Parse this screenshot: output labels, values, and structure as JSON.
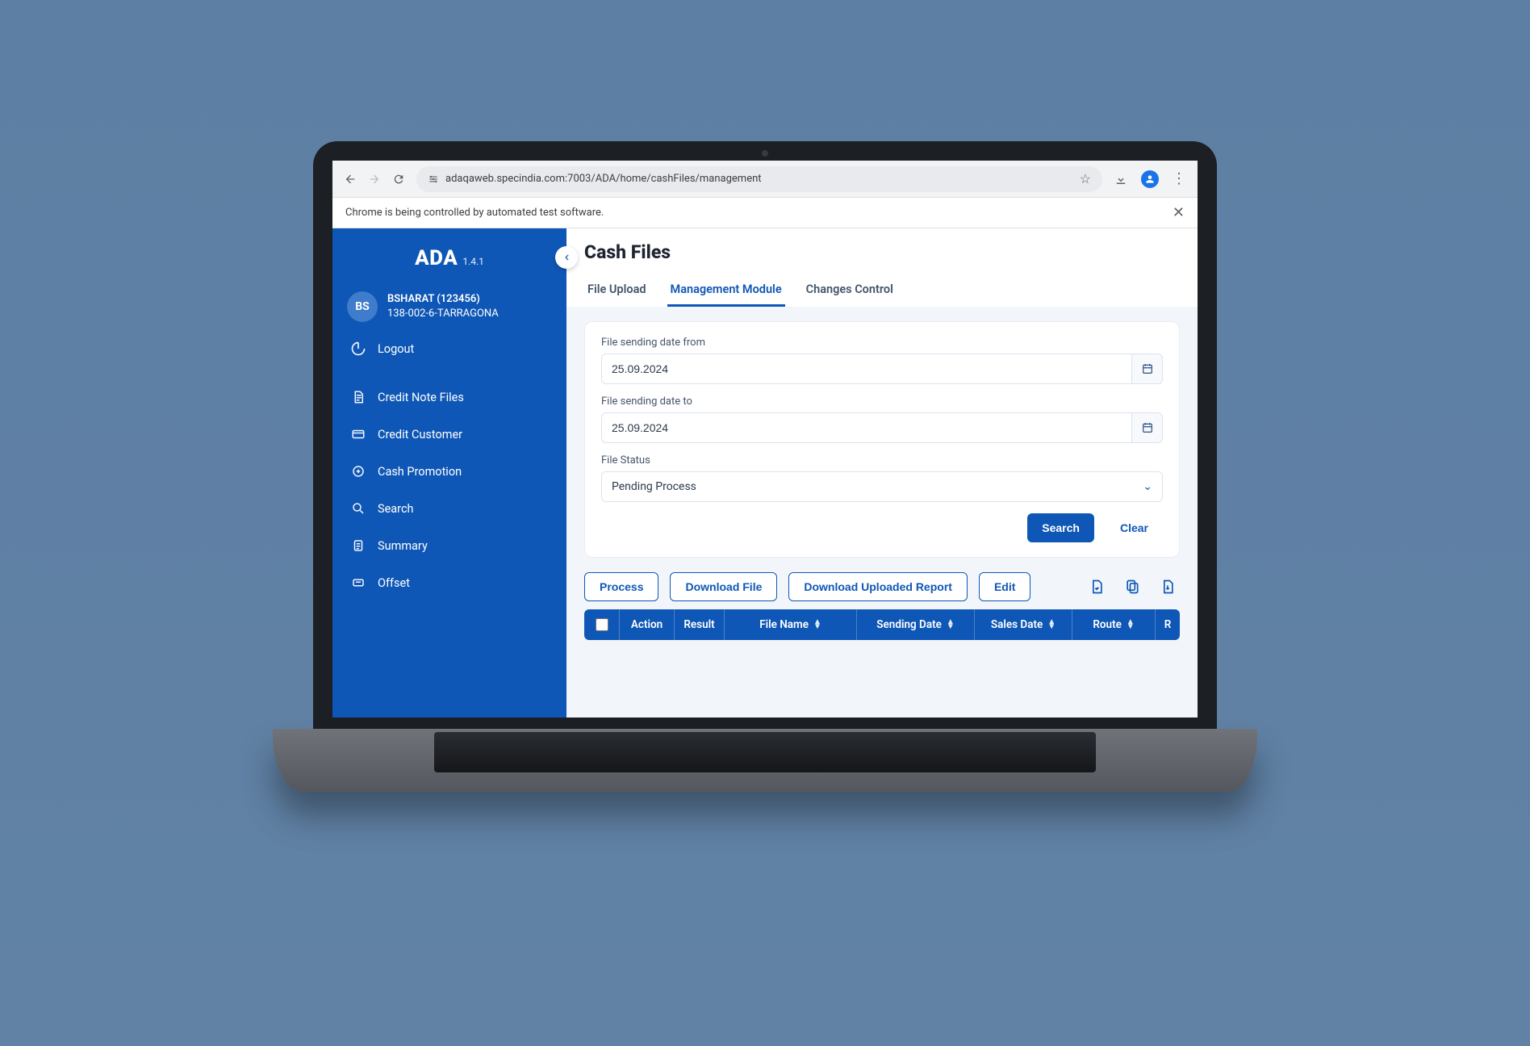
{
  "browser": {
    "url": "adaqaweb.specindia.com:7003/ADA/home/cashFiles/management",
    "infobar": "Chrome is being controlled by automated test software."
  },
  "brand": {
    "name": "ADA",
    "version": "1.4.1"
  },
  "user": {
    "initials": "BS",
    "line1": "BSHARAT (123456)",
    "line2": "138-002-6-TARRAGONA"
  },
  "sidebar": {
    "logout": "Logout",
    "items": [
      "Credit Note Files",
      "Credit Customer",
      "Cash Promotion",
      "Search",
      "Summary",
      "Offset"
    ]
  },
  "page": {
    "title": "Cash Files",
    "tabs": [
      "File Upload",
      "Management Module",
      "Changes Control"
    ],
    "activeTab": 1
  },
  "form": {
    "from": {
      "label": "File sending date from",
      "value": "25.09.2024"
    },
    "to": {
      "label": "File sending date to",
      "value": "25.09.2024"
    },
    "status": {
      "label": "File Status",
      "value": "Pending Process"
    },
    "search": "Search",
    "clear": "Clear"
  },
  "toolbar": {
    "process": "Process",
    "downloadFile": "Download File",
    "downloadReport": "Download Uploaded Report",
    "edit": "Edit"
  },
  "table": {
    "headers": {
      "action": "Action",
      "result": "Result",
      "fileName": "File Name",
      "sendingDate": "Sending Date",
      "salesDate": "Sales Date",
      "route": "Route",
      "rx": "R"
    }
  }
}
